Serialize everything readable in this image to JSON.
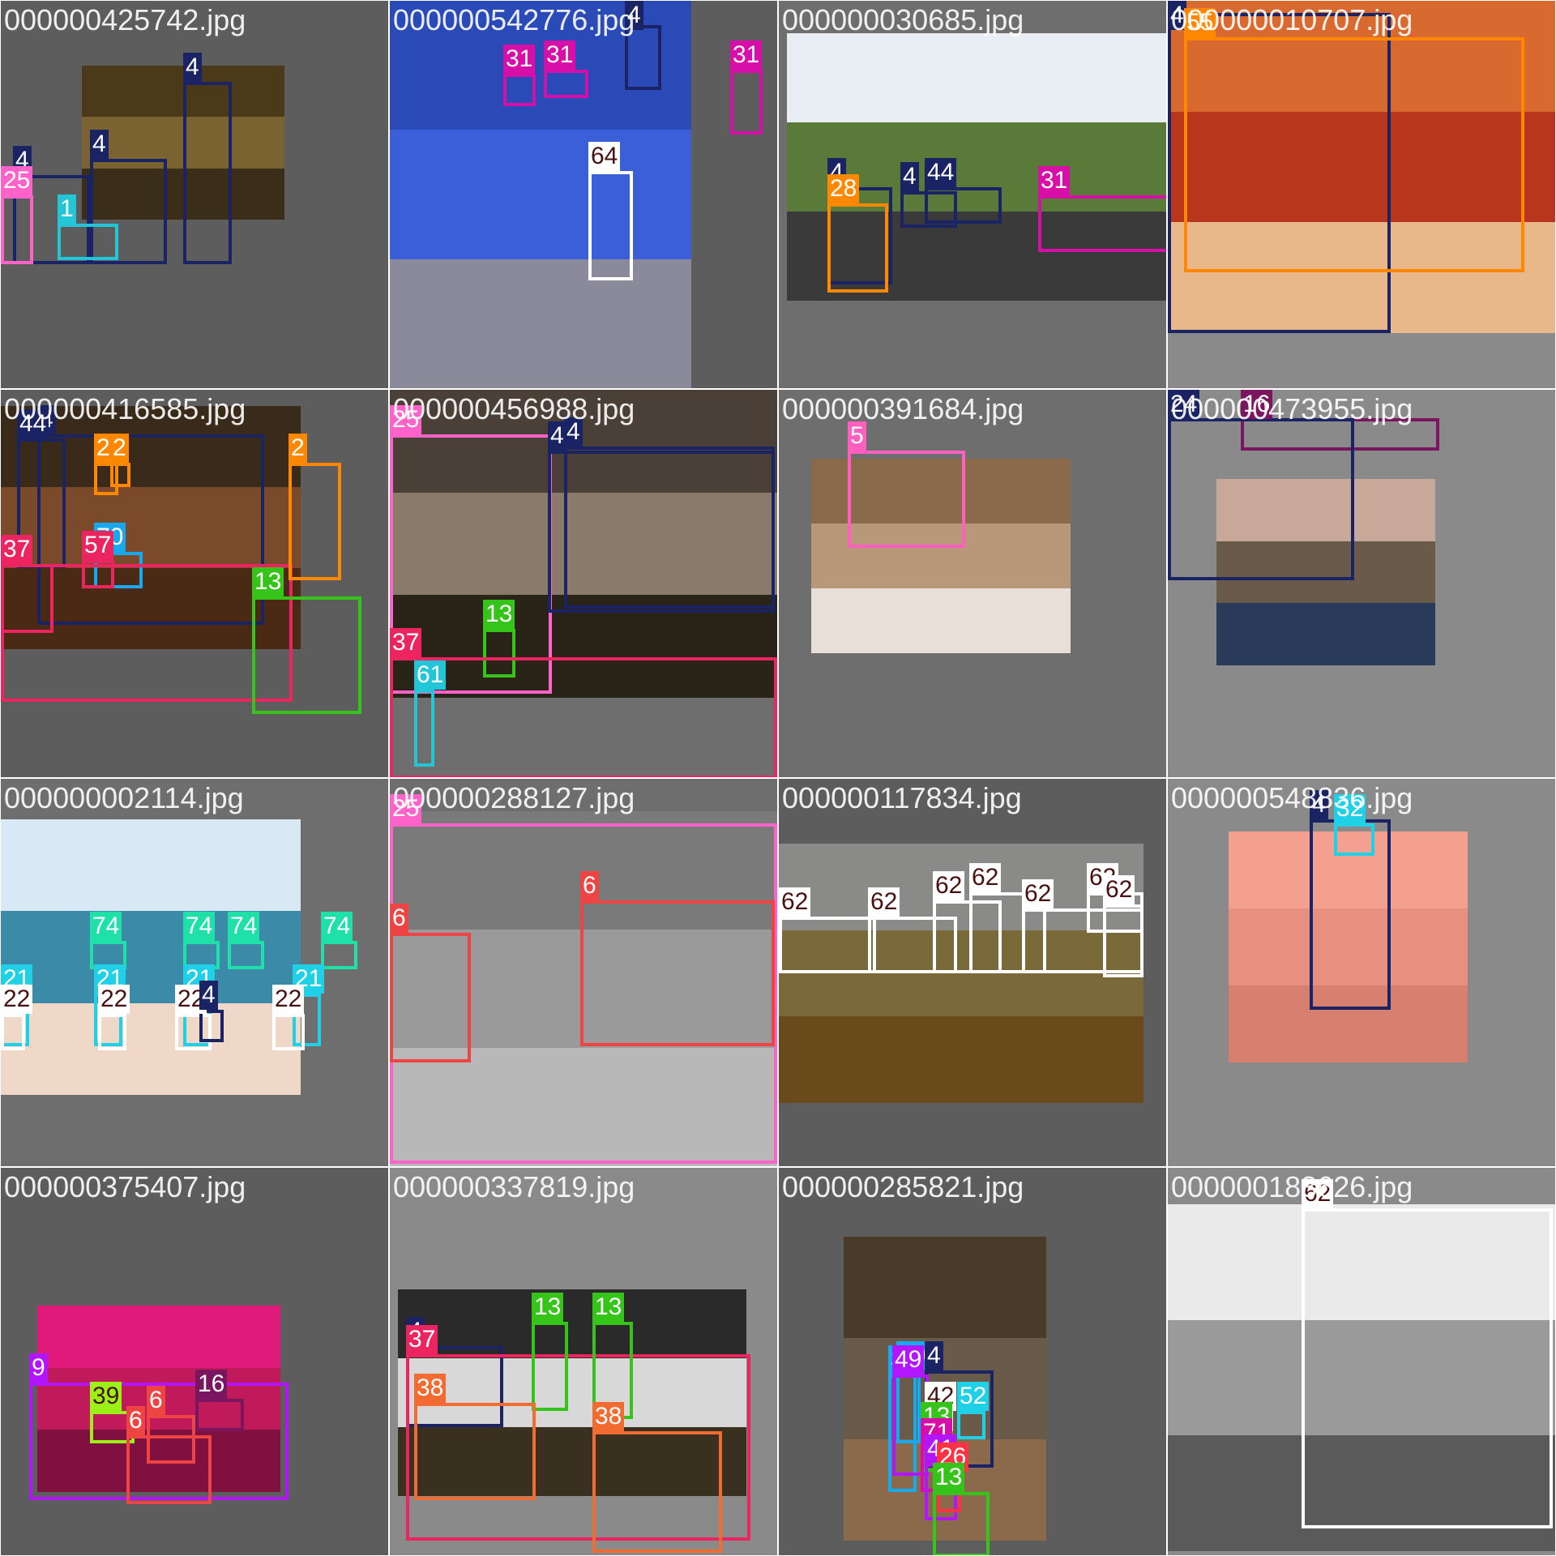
{
  "class_colors": {
    "1": "#22c6d6",
    "4": "#1a2363",
    "5": "#ff5fbf",
    "6": "#ee4444",
    "9": "#b215ff",
    "13": "#36c41a",
    "16": "#7a1560",
    "21": "#1fd0e6",
    "22": "#ffffff",
    "24": "#1a2363",
    "25": "#ff62c8",
    "26": "#ff3344",
    "30": "#18a8ee",
    "31": "#d80ea8",
    "32": "#1fd0e6",
    "37": "#ec2560",
    "38": "#f26b30",
    "39": "#9bf016",
    "41": "#b215ff",
    "42": "#ffffff",
    "44": "#1a2363",
    "49": "#b215ff",
    "52": "#1fd0e6",
    "57": "#ec2560",
    "61": "#22c6d6",
    "62": "#ffffff",
    "64": "#ffffff",
    "70": "#18a8ee",
    "71": "#d80ea8",
    "74": "#1fe0a8"
  },
  "tiles": [
    {
      "filename": "000000425742.jpg",
      "bg": "#5d5d5d",
      "photo": {
        "bands": [
          "#4a3a1a",
          "#7a6330",
          "#3a2e18"
        ]
      },
      "boxes": [
        {
          "cls": "4"
        },
        {
          "cls": "4"
        },
        {
          "cls": "4"
        },
        {
          "cls": "25"
        },
        {
          "cls": "1"
        }
      ]
    },
    {
      "filename": "000000542776.jpg",
      "bg": "#5d5d5d",
      "photo": {
        "bands": [
          "#2a4ab8",
          "#3b5fd8",
          "#8a8a9a"
        ]
      },
      "boxes": [
        {
          "cls": "31"
        },
        {
          "cls": "31"
        },
        {
          "cls": "4"
        },
        {
          "cls": "31"
        },
        {
          "cls": "64"
        }
      ]
    },
    {
      "filename": "000000030685.jpg",
      "bg": "#6e6e6e",
      "photo": {
        "bands": [
          "#e8eef4",
          "#5a7a3a",
          "#3a3a3a"
        ]
      },
      "boxes": [
        {
          "cls": "4"
        },
        {
          "cls": "28"
        },
        {
          "cls": "4"
        },
        {
          "cls": "44"
        },
        {
          "cls": "31"
        }
      ]
    },
    {
      "filename": "000000010707.jpg",
      "bg": "#8a8a8a",
      "photo": {
        "bands": [
          "#d86a30",
          "#b8371c",
          "#e8b88a"
        ]
      },
      "boxes": [
        {
          "cls": "4"
        },
        {
          "cls": "55"
        }
      ]
    },
    {
      "filename": "000000416585.jpg",
      "bg": "#5d5d5d",
      "photo": {
        "bands": [
          "#3a2a1a",
          "#7a4a2a",
          "#4a2a14"
        ]
      },
      "boxes": [
        {
          "cls": "4"
        },
        {
          "cls": "44"
        },
        {
          "cls": "2"
        },
        {
          "cls": "2"
        },
        {
          "cls": "37"
        },
        {
          "cls": "70"
        },
        {
          "cls": "57"
        },
        {
          "cls": "37"
        },
        {
          "cls": "13"
        },
        {
          "cls": "2"
        }
      ]
    },
    {
      "filename": "000000456988.jpg",
      "bg": "#6e6e6e",
      "photo": {
        "bands": [
          "#4a4038",
          "#8a7a6a",
          "#2a2418"
        ]
      },
      "boxes": [
        {
          "cls": "25"
        },
        {
          "cls": "4"
        },
        {
          "cls": "4"
        },
        {
          "cls": "13"
        },
        {
          "cls": "37"
        },
        {
          "cls": "61"
        }
      ]
    },
    {
      "filename": "000000391684.jpg",
      "bg": "#6e6e6e",
      "photo": {
        "bands": [
          "#8a6a4a",
          "#b89878",
          "#e8e0d8"
        ]
      },
      "boxes": [
        {
          "cls": "5"
        }
      ]
    },
    {
      "filename": "000000473955.jpg",
      "bg": "#8a8a8a",
      "photo": {
        "bands": [
          "#c8a898",
          "#6a5a4a",
          "#2a3a5a"
        ]
      },
      "boxes": [
        {
          "cls": "16"
        },
        {
          "cls": "24"
        }
      ]
    },
    {
      "filename": "000000002114.jpg",
      "bg": "#6e6e6e",
      "photo": {
        "bands": [
          "#d8e8f4",
          "#3a8aa8",
          "#f0d8c8"
        ]
      },
      "boxes": [
        {
          "cls": "74"
        },
        {
          "cls": "74"
        },
        {
          "cls": "74"
        },
        {
          "cls": "74"
        },
        {
          "cls": "21"
        },
        {
          "cls": "21"
        },
        {
          "cls": "21"
        },
        {
          "cls": "21"
        },
        {
          "cls": "22"
        },
        {
          "cls": "22"
        },
        {
          "cls": "22"
        },
        {
          "cls": "22"
        },
        {
          "cls": "4"
        }
      ]
    },
    {
      "filename": "000000288127.jpg",
      "bg": "#6e6e6e",
      "photo": {
        "bands": [
          "#7a7a7a",
          "#9a9a9a",
          "#b8b8b8"
        ]
      },
      "boxes": [
        {
          "cls": "25"
        },
        {
          "cls": "6"
        },
        {
          "cls": "6"
        }
      ]
    },
    {
      "filename": "000000117834.jpg",
      "bg": "#5d5d5d",
      "photo": {
        "bands": [
          "#8a8a88",
          "#7a6a3a",
          "#6a4a1a"
        ]
      },
      "boxes": [
        {
          "cls": "62"
        },
        {
          "cls": "62"
        },
        {
          "cls": "62"
        },
        {
          "cls": "62"
        },
        {
          "cls": "62"
        },
        {
          "cls": "62"
        },
        {
          "cls": "62"
        }
      ]
    },
    {
      "filename": "000000548836.jpg",
      "bg": "#8a8a8a",
      "photo": {
        "bands": [
          "#f4a090",
          "#e89080",
          "#d88070"
        ]
      },
      "boxes": [
        {
          "cls": "4"
        },
        {
          "cls": "32"
        }
      ]
    },
    {
      "filename": "000000375407.jpg",
      "bg": "#5d5d5d",
      "photo": {
        "bands": [
          "#e01a7a",
          "#c01a5a",
          "#801040"
        ]
      },
      "boxes": [
        {
          "cls": "9"
        },
        {
          "cls": "39"
        },
        {
          "cls": "6"
        },
        {
          "cls": "16"
        },
        {
          "cls": "6"
        }
      ]
    },
    {
      "filename": "000000337819.jpg",
      "bg": "#8a8a8a",
      "photo": {
        "bands": [
          "#2a2a2a",
          "#d8d8d8",
          "#3a3020"
        ]
      },
      "boxes": [
        {
          "cls": "4"
        },
        {
          "cls": "37"
        },
        {
          "cls": "13"
        },
        {
          "cls": "13"
        },
        {
          "cls": "38"
        },
        {
          "cls": "38"
        }
      ]
    },
    {
      "filename": "000000285821.jpg",
      "bg": "#5d5d5d",
      "photo": {
        "bands": [
          "#4a3a2a",
          "#6a5a4a",
          "#8a6a4a"
        ]
      },
      "boxes": [
        {
          "cls": "30"
        },
        {
          "cls": "4"
        },
        {
          "cls": "30"
        },
        {
          "cls": "49"
        },
        {
          "cls": "42"
        },
        {
          "cls": "52"
        },
        {
          "cls": "13"
        },
        {
          "cls": "71"
        },
        {
          "cls": "41"
        },
        {
          "cls": "26"
        },
        {
          "cls": "13"
        }
      ]
    },
    {
      "filename": "000000183626.jpg",
      "bg": "#8a8a8a",
      "photo": {
        "bands": [
          "#eaeaea",
          "#9a9a9a",
          "#5a5a5a"
        ]
      },
      "boxes": [
        {
          "cls": "62"
        }
      ]
    }
  ]
}
